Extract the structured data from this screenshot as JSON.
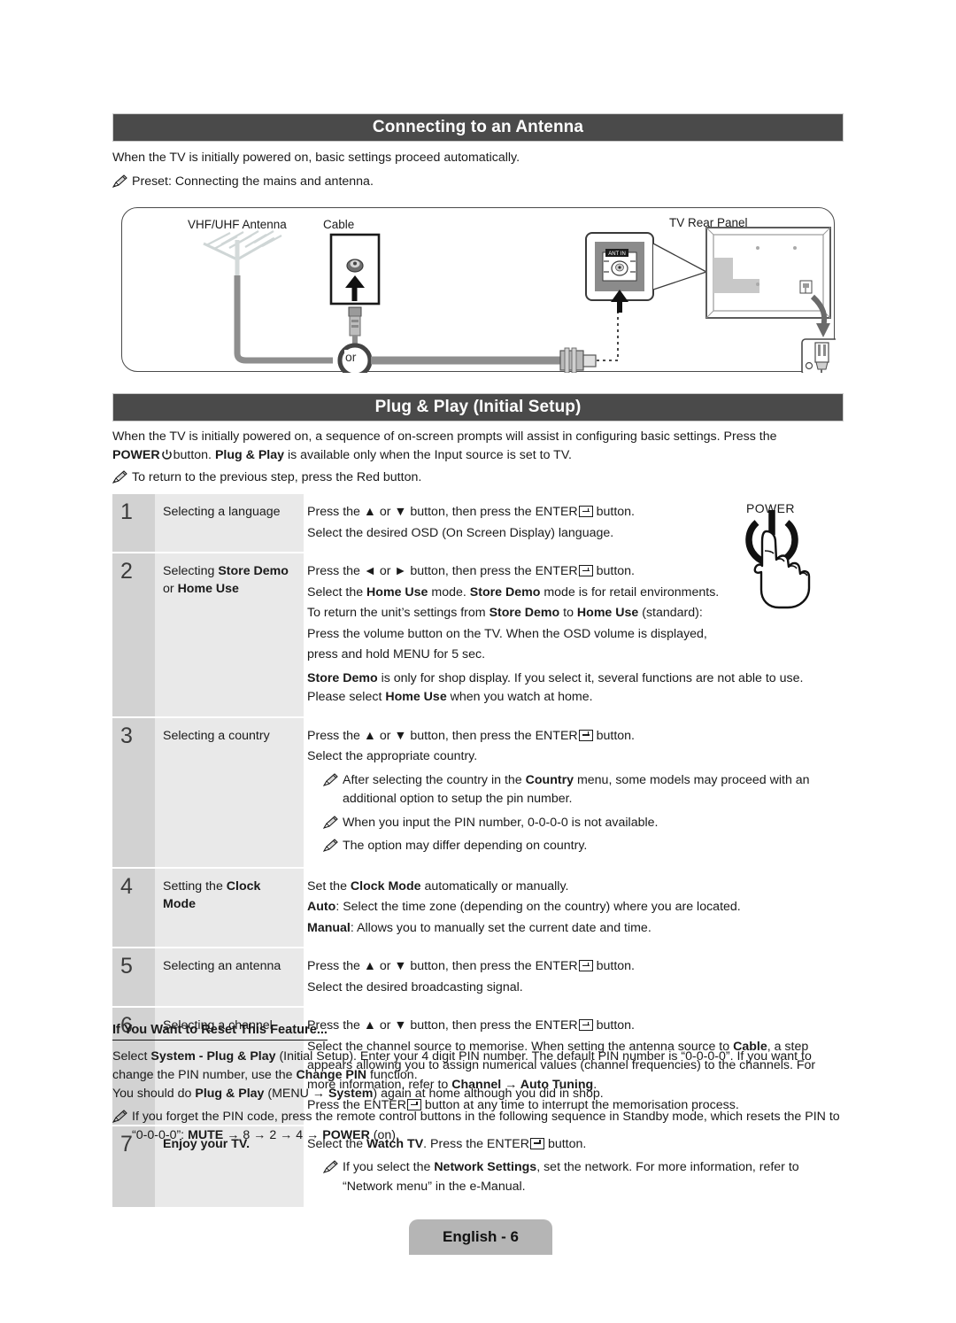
{
  "sections": {
    "antenna": {
      "title": "Connecting to an Antenna",
      "intro": "When the TV is initially powered on, basic settings proceed automatically.",
      "note": "Preset: Connecting the mains and antenna."
    },
    "plugplay": {
      "title": "Plug & Play (Initial Setup)",
      "intro_line1": "When the TV is initially powered on, a sequence of on-screen prompts will assist in configuring basic settings. Press the",
      "intro_line2_a": "POWER",
      "intro_line2_b": "button.",
      "intro_line2_c": "Plug & Play",
      "intro_line2_d": "is available only when the Input source is set to TV.",
      "note": "To return to the previous step, press the Red button."
    }
  },
  "diagram": {
    "labels": {
      "antenna": "VHF/UHF Antenna",
      "cable": "Cable",
      "rear_panel": "TV Rear Panel",
      "or": "or",
      "ant_in": "ANT IN"
    }
  },
  "power_illustration": {
    "label": "POWER"
  },
  "steps": [
    {
      "num": "1",
      "label_plain": "Selecting a language",
      "lines": [
        "Press the ▲ or ▼ button, then press the ENTER [key] button.",
        "Select the desired OSD (On Screen Display) language."
      ]
    },
    {
      "num": "2",
      "label_plain": "Selecting Store Demo or Home Use",
      "lines": [
        "Press the ◄ or ► button, then press the ENTER [key] button.",
        "Select the Home Use mode. Store Demo mode is for retail environments.",
        "To return the unit's settings from Store Demo to Home Use (standard):",
        "Press the volume button on the TV. When the OSD volume is displayed,",
        "press and hold MENU for 5 sec.",
        "Store Demo is only for shop display. If you select it, several functions are not able to use. Please select Home Use when you watch at home."
      ]
    },
    {
      "num": "3",
      "label_plain": "Selecting a country",
      "lines": [
        "Press the ▲ or ▼ button, then press the ENTER [key] button.",
        "Select the appropriate country.",
        "After selecting the country in the Country menu, some models may proceed with an additional option to setup the pin number.",
        "When you input the PIN number, 0-0-0-0 is not available.",
        "The option may differ depending on country."
      ]
    },
    {
      "num": "4",
      "label_plain": "Setting the Clock Mode",
      "lines": [
        "Set the Clock Mode automatically or manually.",
        "Auto: Select the time zone (depending on the country) where you are located.",
        "Manual: Allows you to manually set the current date and time."
      ]
    },
    {
      "num": "5",
      "label_plain": "Selecting an antenna",
      "lines": [
        "Press the ▲ or ▼ button, then press the ENTER [key] button.",
        "Select the desired broadcasting signal."
      ]
    },
    {
      "num": "6",
      "label_plain": "Selecting a channel",
      "lines": [
        "Press the ▲ or ▼ button, then press the ENTER [key] button.",
        "Select the channel source to memorise. When setting the antenna source to Cable, a step appears allowing you to assign numerical values (channel frequencies) to the channels. For more information, refer to Channel → Auto Tuning.",
        "Press the ENTER [key] button at any time to interrupt the memorisation process."
      ]
    },
    {
      "num": "7",
      "label_plain": "Enjoy your TV.",
      "lines": [
        "Select the Watch TV. Press the ENTER [key] button.",
        "If you select the Network Settings, set the network. For more information, refer to “Network menu” in the e-Manual."
      ]
    }
  ],
  "reset": {
    "heading": "If You Want to Reset This Feature...",
    "para1": "Select System - Plug & Play (Initial Setup). Enter your 4 digit PIN number. The default PIN number is “0-0-0-0”. If you want to change the PIN number, use the Change PIN function.",
    "para2": "You should do Plug & Play (MENU → System) again at home although you did in shop.",
    "note": "If you forget the PIN code, press the remote control buttons in the following sequence in Standby mode, which resets the PIN to “0-0-0-0”: MUTE → 8 → 2 → 4 → POWER (on)."
  },
  "footer": {
    "page_label": "English - 6"
  },
  "colors": {
    "header_bar": "#4a4a4a",
    "step_num_bg": "#d2d2d2",
    "step_label_bg": "#e9e9e9",
    "footer_pill": "#b5b5b5"
  }
}
